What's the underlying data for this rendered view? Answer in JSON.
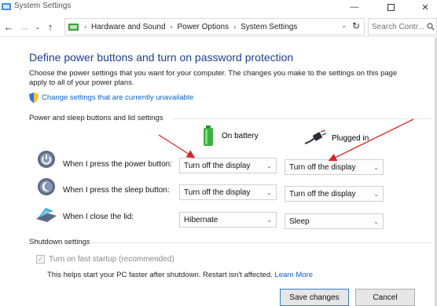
{
  "window": {
    "title": "System Settings"
  },
  "nav": {
    "breadcrumbs": [
      "Hardware and Sound",
      "Power Options",
      "System Settings"
    ],
    "search_placeholder": "Search Contr..."
  },
  "page": {
    "heading": "Define power buttons and turn on password protection",
    "description": "Choose the power settings that you want for your computer. The changes you make to the settings on this page apply to all of your power plans.",
    "change_link": "Change settings that are currently unavailable"
  },
  "power_section": {
    "title": "Power and sleep buttons and lid settings",
    "columns": {
      "battery": "On battery",
      "plugged": "Plugged in"
    },
    "rows": [
      {
        "label": "When I press the power button:",
        "battery": "Turn off the display",
        "plugged": "Turn off the display"
      },
      {
        "label": "When I press the sleep button:",
        "battery": "Turn off the display",
        "plugged": "Turn off the display"
      },
      {
        "label": "When I close the lid:",
        "battery": "Hibernate",
        "plugged": "Sleep"
      }
    ]
  },
  "shutdown_section": {
    "title": "Shutdown settings",
    "fast_startup_label": "Turn on fast startup (recommended)",
    "fast_startup_checked": true,
    "help_text": "This helps start your PC faster after shutdown. Restart isn't affected.",
    "learn_more": "Learn More"
  },
  "footer": {
    "save": "Save changes",
    "cancel": "Cancel"
  },
  "colors": {
    "heading": "#1e3e90",
    "link": "#0b63c5",
    "annotation_arrow": "#d9252a",
    "battery_green": "#3cb043"
  }
}
